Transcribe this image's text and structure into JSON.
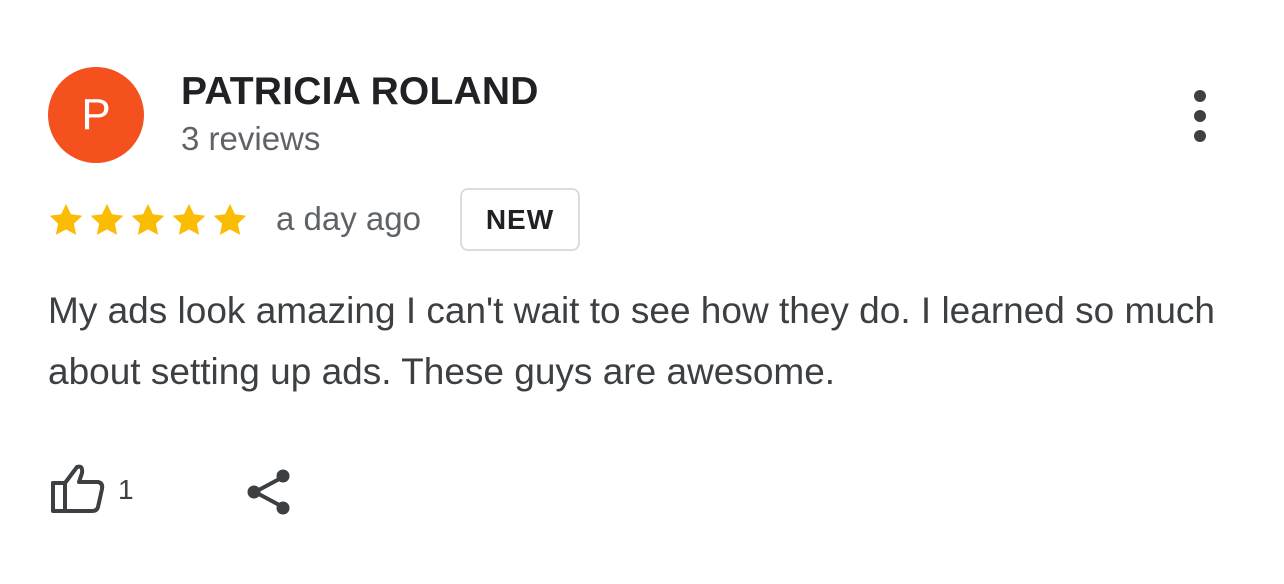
{
  "review": {
    "author": {
      "initial": "P",
      "name": "PATRICIA ROLAND",
      "review_count": "3 reviews",
      "avatar_color": "#F4511E"
    },
    "rating": {
      "value": 5,
      "max": 5,
      "star_color": "#FBBC04"
    },
    "time_ago": "a day ago",
    "badge": "NEW",
    "text": "My ads look amazing I can't wait to see how they do. I learned so much about setting up ads. These guys are awesome.",
    "actions": {
      "like_icon": "thumbs-up-icon",
      "like_count": "1",
      "share_icon": "share-icon",
      "more_icon": "more-vert-icon"
    }
  }
}
